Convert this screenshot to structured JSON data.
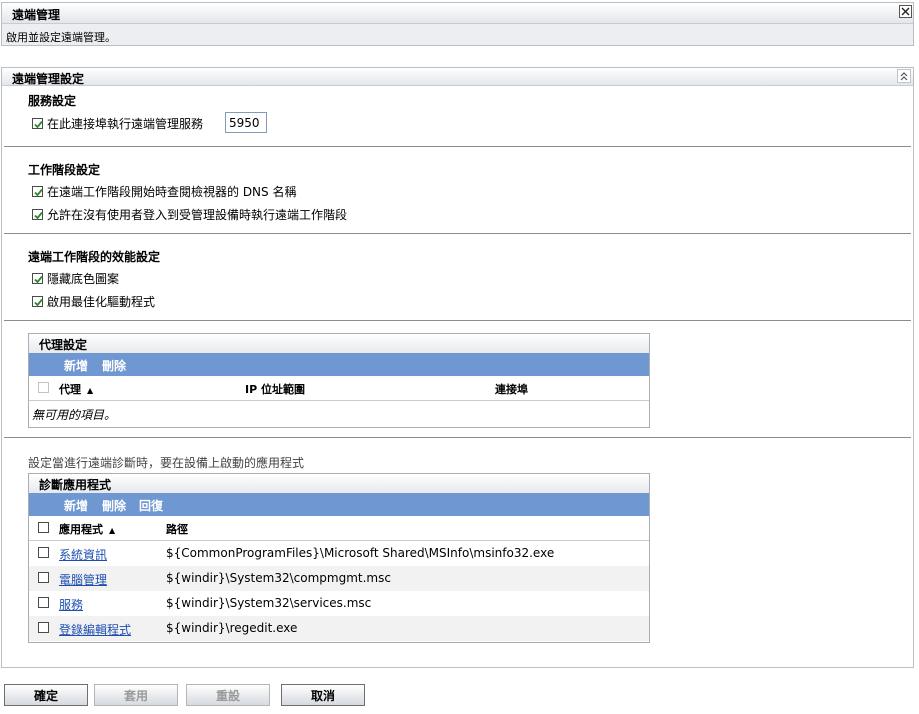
{
  "header": {
    "title": "遠端管理",
    "description": "啟用並設定遠端管理。"
  },
  "panel": {
    "title": "遠端管理設定",
    "service": {
      "heading": "服務設定",
      "run_service_label": "在此連接埠執行遠端管理服務",
      "run_service_checked": true,
      "port_value": "5950"
    },
    "session": {
      "heading": "工作階段設定",
      "options": [
        {
          "label": "在遠端工作階段開始時查閱檢視器的 DNS 名稱",
          "checked": true
        },
        {
          "label": "允許在沒有使用者登入到受管理設備時執行遠端工作階段",
          "checked": true
        }
      ]
    },
    "performance": {
      "heading": "遠端工作階段的效能設定",
      "options": [
        {
          "label": "隱藏底色圖案",
          "checked": true
        },
        {
          "label": "啟用最佳化驅動程式",
          "checked": true
        }
      ]
    },
    "proxy": {
      "title": "代理設定",
      "toolbar": {
        "add": "新增",
        "delete": "刪除"
      },
      "columns": [
        "代理",
        "IP 位址範圍",
        "連接埠"
      ],
      "empty_text": "無可用的項目。"
    },
    "diagnostics": {
      "caption": "設定當進行遠端診斷時，要在設備上啟動的應用程式",
      "title": "診斷應用程式",
      "toolbar": {
        "add": "新增",
        "delete": "刪除",
        "revert": "回復"
      },
      "columns": [
        "應用程式",
        "路徑"
      ],
      "rows": [
        {
          "name": "系統資訊",
          "path": "${CommonProgramFiles}\\Microsoft Shared\\MSInfo\\msinfo32.exe"
        },
        {
          "name": "電腦管理",
          "path": "${windir}\\System32\\compmgmt.msc"
        },
        {
          "name": "服務",
          "path": "${windir}\\System32\\services.msc"
        },
        {
          "name": "登錄編輯程式",
          "path": "${windir}\\regedit.exe"
        }
      ]
    }
  },
  "buttons": {
    "ok": "確定",
    "apply": "套用",
    "reset": "重設",
    "cancel": "取消"
  },
  "colors": {
    "toolbar_blue": "#6f97d1",
    "link_blue": "#1e4fb0",
    "header_bg": "#eceef2",
    "check_green": "#2a8a2a"
  }
}
